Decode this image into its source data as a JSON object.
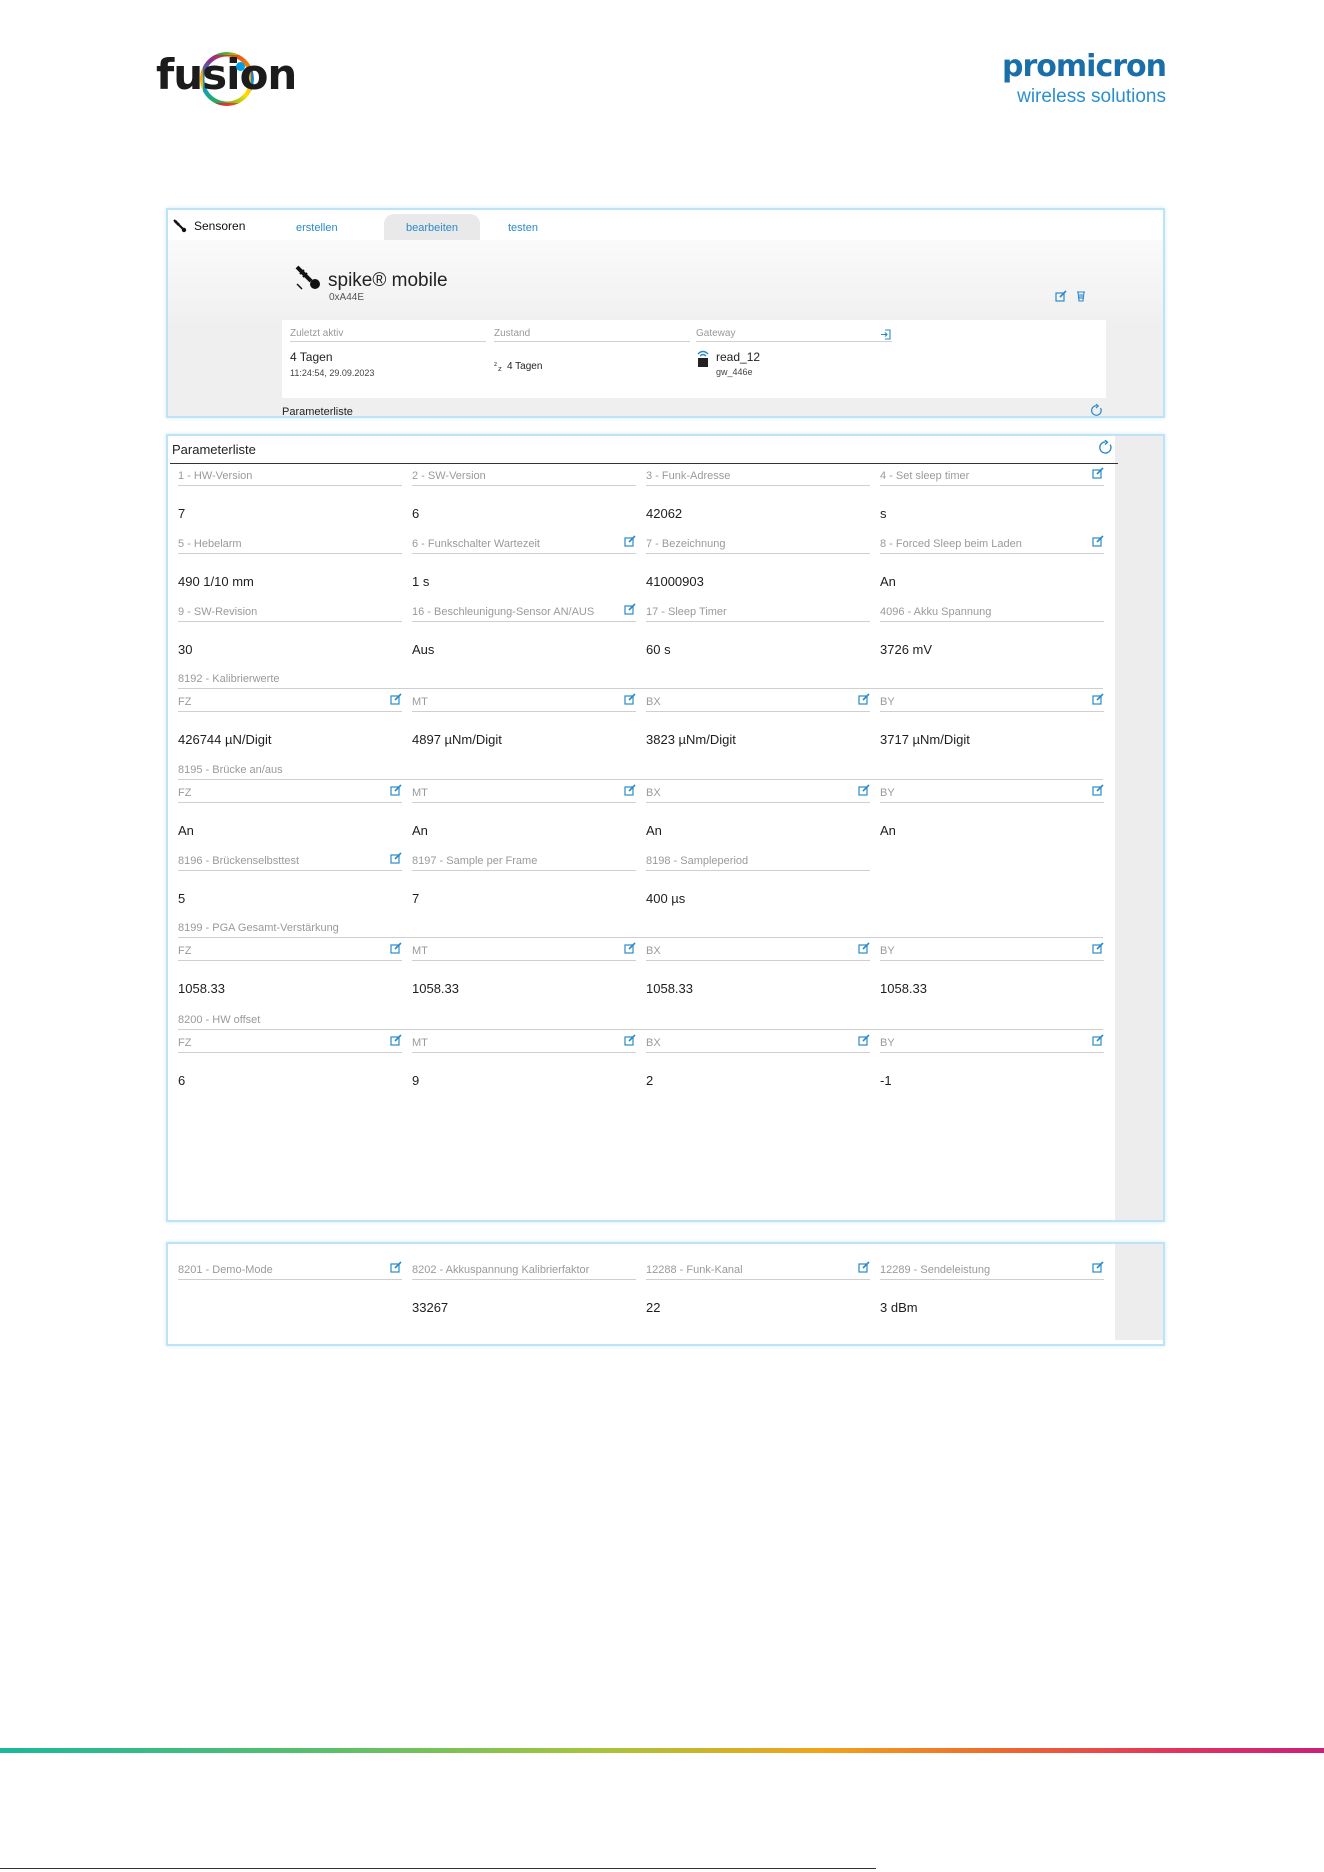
{
  "branding": {
    "left_logo": "fusion",
    "right_logo_name": "promicron",
    "right_logo_tagline": "wireless solutions"
  },
  "colors": {
    "accent": "#2b8ac8",
    "panel_border": "#bfe3f6",
    "label": "#9a9a9a"
  },
  "topbar": {
    "section": "Sensoren",
    "tabs": [
      "erstellen",
      "bearbeiten",
      "testen"
    ],
    "active_tab": "bearbeiten"
  },
  "device": {
    "name": "spike® mobile",
    "id": "0xA44E",
    "last_active_label": "Zuletzt aktiv",
    "last_active_value": "4 Tagen",
    "last_active_time": "11:24:54, 29.09.2023",
    "state_label": "Zustand",
    "state_value": "4 Tagen",
    "gateway_label": "Gateway",
    "gateway_name": "read_12",
    "gateway_id": "gw_446e",
    "footer_label": "Parameterliste"
  },
  "params": {
    "title": "Parameterliste",
    "row1": [
      {
        "label": "1 - HW-Version",
        "value": "7",
        "editable": false
      },
      {
        "label": "2 - SW-Version",
        "value": "6",
        "editable": false
      },
      {
        "label": "3 - Funk-Adresse",
        "value": "42062",
        "editable": false
      },
      {
        "label": "4 - Set sleep timer",
        "value": "s",
        "editable": true
      }
    ],
    "row2": [
      {
        "label": "5 - Hebelarm",
        "value": "490 1/10 mm",
        "editable": false
      },
      {
        "label": "6 - Funkschalter Wartezeit",
        "value": "1 s",
        "editable": true
      },
      {
        "label": "7 - Bezeichnung",
        "value": "41000903",
        "editable": false
      },
      {
        "label": "8 - Forced Sleep beim Laden",
        "value": "An",
        "editable": true
      }
    ],
    "row3": [
      {
        "label": "9 - SW-Revision",
        "value": "30",
        "editable": false
      },
      {
        "label": "16 - Beschleunigung-Sensor AN/AUS",
        "value": "Aus",
        "editable": true
      },
      {
        "label": "17 - Sleep Timer",
        "value": "60 s",
        "editable": false
      },
      {
        "label": "4096 - Akku Spannung",
        "value": "3726 mV",
        "editable": false
      }
    ],
    "group_8192": {
      "label": "8192 - Kalibrierwerte",
      "fields": [
        {
          "label": "FZ",
          "value": "426744 µN/Digit",
          "editable": true
        },
        {
          "label": "MT",
          "value": "4897 µNm/Digit",
          "editable": true
        },
        {
          "label": "BX",
          "value": "3823 µNm/Digit",
          "editable": true
        },
        {
          "label": "BY",
          "value": "3717 µNm/Digit",
          "editable": true
        }
      ]
    },
    "group_8195": {
      "label": "8195 - Brücke an/aus",
      "fields": [
        {
          "label": "FZ",
          "value": "An",
          "editable": true
        },
        {
          "label": "MT",
          "value": "An",
          "editable": true
        },
        {
          "label": "BX",
          "value": "An",
          "editable": true
        },
        {
          "label": "BY",
          "value": "An",
          "editable": true
        }
      ]
    },
    "row4": [
      {
        "label": "8196 - Brückenselbsttest",
        "value": "5",
        "editable": true
      },
      {
        "label": "8197 - Sample per Frame",
        "value": "7",
        "editable": false
      },
      {
        "label": "8198 - Sampleperiod",
        "value": "400 µs",
        "editable": false
      }
    ],
    "group_8199": {
      "label": "8199 - PGA Gesamt-Verstärkung",
      "fields": [
        {
          "label": "FZ",
          "value": "1058.33",
          "editable": true
        },
        {
          "label": "MT",
          "value": "1058.33",
          "editable": true
        },
        {
          "label": "BX",
          "value": "1058.33",
          "editable": true
        },
        {
          "label": "BY",
          "value": "1058.33",
          "editable": true
        }
      ]
    },
    "group_8200": {
      "label": "8200 - HW offset",
      "fields": [
        {
          "label": "FZ",
          "value": "6",
          "editable": true
        },
        {
          "label": "MT",
          "value": "9",
          "editable": true
        },
        {
          "label": "BX",
          "value": "2",
          "editable": true
        },
        {
          "label": "BY",
          "value": "-1",
          "editable": true
        }
      ]
    }
  },
  "params2": [
    {
      "label": "8201 - Demo-Mode",
      "value": "",
      "editable": true
    },
    {
      "label": "8202 - Akkuspannung Kalibrierfaktor",
      "value": "33267",
      "editable": false
    },
    {
      "label": "12288 - Funk-Kanal",
      "value": "22",
      "editable": true
    },
    {
      "label": "12289 - Sendeleistung",
      "value": "3 dBm",
      "editable": true
    }
  ]
}
